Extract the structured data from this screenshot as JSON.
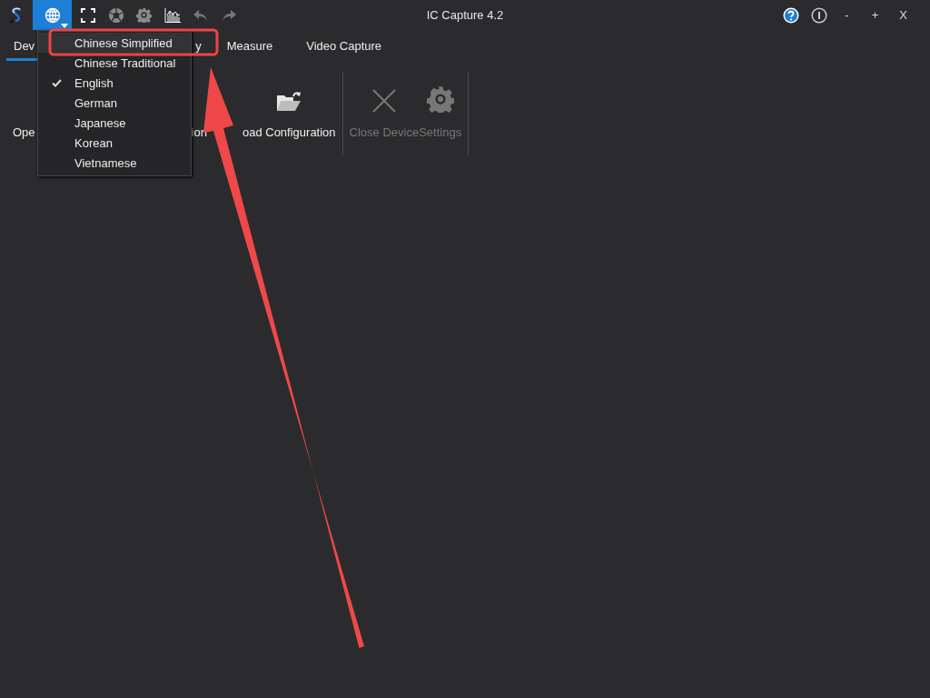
{
  "window": {
    "title": "IC Capture 4.2",
    "controls": [
      {
        "kind": "help"
      },
      {
        "kind": "info"
      },
      {
        "kind": "text",
        "label": "-"
      },
      {
        "kind": "text",
        "label": "+"
      },
      {
        "kind": "text",
        "label": "X"
      }
    ]
  },
  "toolbar": [
    {
      "kind": "globe",
      "selected": true
    },
    {
      "kind": "fullscreen",
      "selected": false
    },
    {
      "kind": "aperture",
      "selected": false
    },
    {
      "kind": "gear",
      "selected": false
    },
    {
      "kind": "histogram",
      "selected": false
    },
    {
      "kind": "undo",
      "selected": false
    },
    {
      "kind": "redo",
      "selected": false
    }
  ],
  "tabs": [
    {
      "label": "Dev",
      "selected": true
    },
    {
      "label": "y",
      "selected": false
    },
    {
      "label": "Measure",
      "selected": false
    },
    {
      "label": "Video Capture",
      "selected": false
    }
  ],
  "ribbon": [
    {
      "kind": "button",
      "label": "Ope",
      "disabled": false
    },
    {
      "kind": "button",
      "label": "ion",
      "disabled": false
    },
    {
      "kind": "button",
      "label": "oad Configuration",
      "disabled": false
    },
    {
      "kind": "separator"
    },
    {
      "kind": "button",
      "label": "Close Device",
      "disabled": true
    },
    {
      "kind": "button",
      "label": "Settings",
      "disabled": true
    },
    {
      "kind": "separator"
    }
  ],
  "language_menu": [
    {
      "label": "Chinese Simplified",
      "checked": false,
      "highlighted": true
    },
    {
      "label": "Chinese Traditional",
      "checked": false,
      "highlighted": false
    },
    {
      "label": "English",
      "checked": true,
      "highlighted": false
    },
    {
      "label": "German",
      "checked": false,
      "highlighted": false
    },
    {
      "label": "Japanese",
      "checked": false,
      "highlighted": false
    },
    {
      "label": "Korean",
      "checked": false,
      "highlighted": false
    },
    {
      "label": "Vietnamese",
      "checked": false,
      "highlighted": false
    }
  ]
}
